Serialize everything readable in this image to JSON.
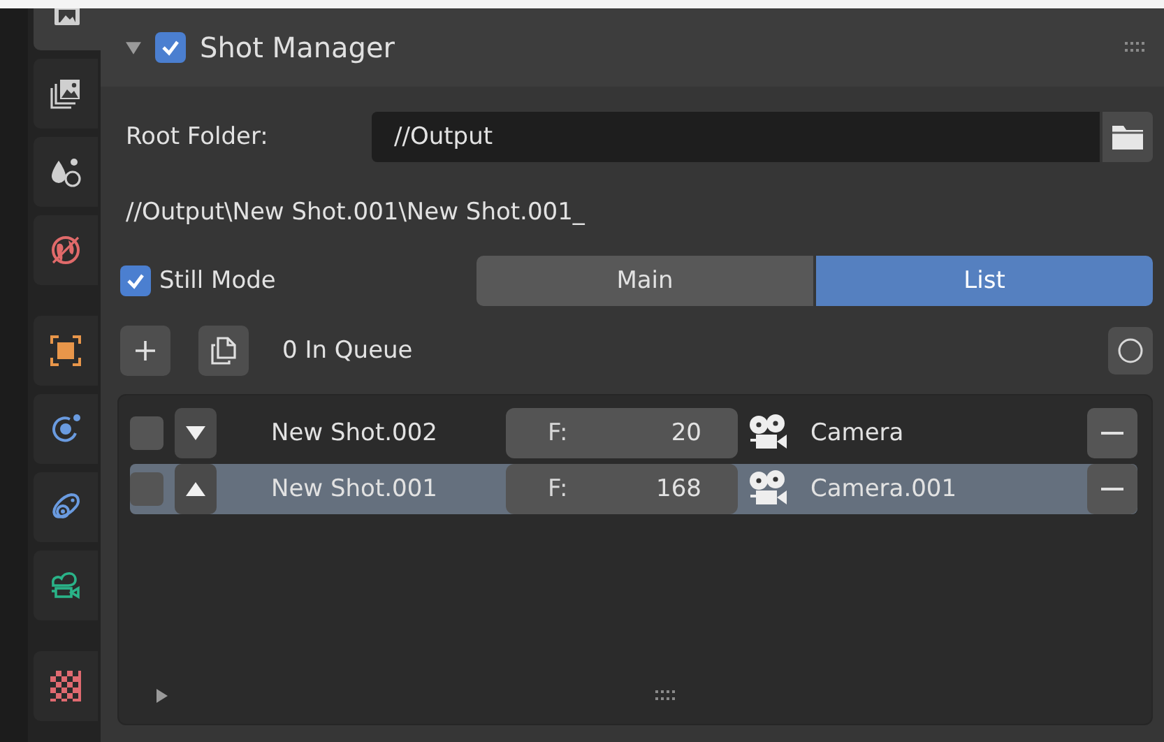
{
  "sidebar": {
    "tabs": [
      {
        "selected": true
      },
      {
        "selected": false
      },
      {
        "selected": false
      },
      {
        "selected": false
      },
      {
        "selected": false
      },
      {
        "selected": false
      },
      {
        "selected": false
      },
      {
        "selected": false
      },
      {
        "selected": false
      }
    ]
  },
  "panel": {
    "title": "Shot Manager",
    "enabled": true,
    "expanded": true
  },
  "root_folder": {
    "label": "Root Folder:",
    "value": "//Output"
  },
  "output_path": "//Output\\New Shot.001\\New Shot.001_",
  "still_mode": {
    "label": "Still Mode",
    "checked": true
  },
  "view_tabs": [
    {
      "label": "Main",
      "selected": false
    },
    {
      "label": "List",
      "selected": true
    }
  ],
  "queue": {
    "label": "0 In Queue"
  },
  "shots": [
    {
      "name": "New Shot.002",
      "checked": false,
      "selected": false,
      "frame_label": "F:",
      "frame": "20",
      "camera": "Camera"
    },
    {
      "name": "New Shot.001",
      "checked": false,
      "selected": true,
      "frame_label": "F:",
      "frame": "168",
      "camera": "Camera.001"
    }
  ]
}
